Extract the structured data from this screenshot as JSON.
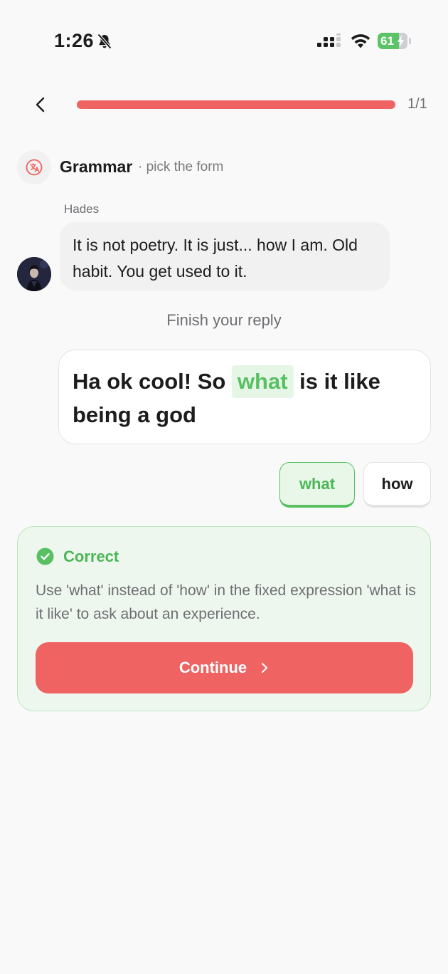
{
  "status_bar": {
    "time": "1:26",
    "battery": "61"
  },
  "header": {
    "progress_count": "1/1",
    "progress_fraction": 1.0
  },
  "exercise": {
    "title": "Grammar",
    "subtitle": "· pick the form"
  },
  "message": {
    "sender": "Hades",
    "text": "It is not poetry. It is just... how I am. Old habit. You get used to it."
  },
  "instruction": "Finish your reply",
  "reply": {
    "before": "Ha ok cool! So ",
    "blank": "what",
    "after": " is it like being a god"
  },
  "options": [
    {
      "label": "what",
      "state": "correct-selected"
    },
    {
      "label": "how",
      "state": "default"
    }
  ],
  "feedback": {
    "title": "Correct",
    "text": "Use 'what' instead of 'how' in the fixed expression 'what is it like' to ask about an experience.",
    "continue_label": "Continue"
  },
  "colors": {
    "accent": "#ef6363",
    "success": "#58c062",
    "success_bg": "#eef7ee",
    "background": "#f9f9f9"
  },
  "icons": [
    "bell-slash-icon",
    "signal-icon",
    "wifi-icon",
    "battery-icon",
    "back-chevron-icon",
    "translate-icon",
    "check-circle-icon",
    "chevron-right-icon"
  ]
}
